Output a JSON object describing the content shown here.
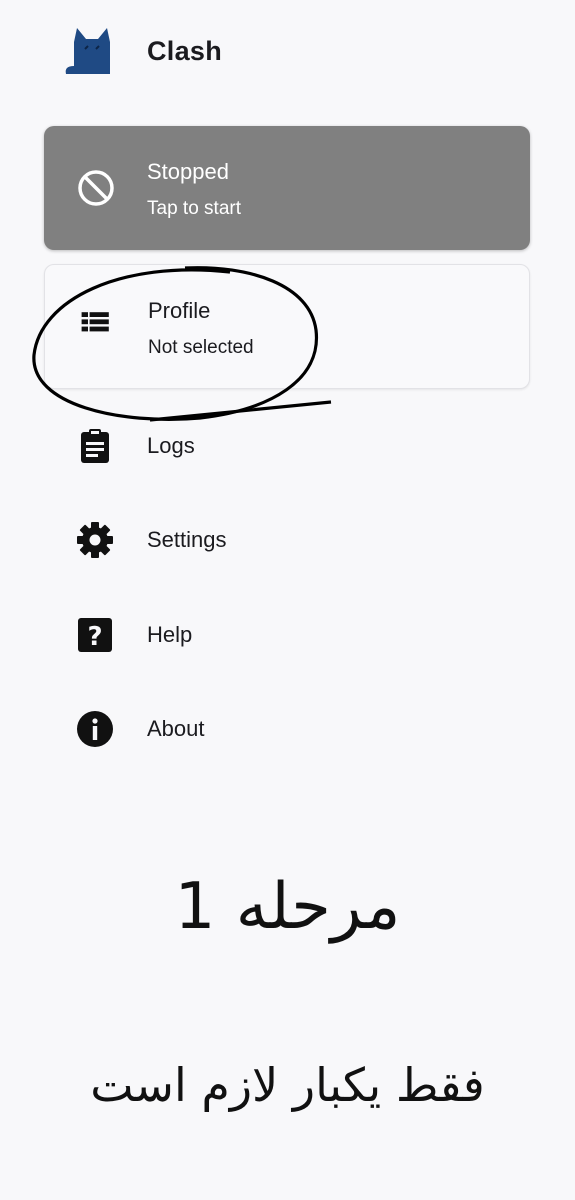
{
  "app": {
    "title": "Clash"
  },
  "status_card": {
    "title": "Stopped",
    "subtitle": "Tap to start",
    "icon": "block-icon",
    "background": "#808080"
  },
  "profile_card": {
    "title": "Profile",
    "subtitle": "Not selected",
    "icon": "list-icon"
  },
  "menu": [
    {
      "label": "Logs",
      "icon": "clipboard-icon"
    },
    {
      "label": "Settings",
      "icon": "gear-icon"
    },
    {
      "label": "Help",
      "icon": "help-icon"
    },
    {
      "label": "About",
      "icon": "info-icon"
    }
  ],
  "notes": {
    "step": "مرحله 1",
    "once": "فقط یکبار لازم است"
  }
}
